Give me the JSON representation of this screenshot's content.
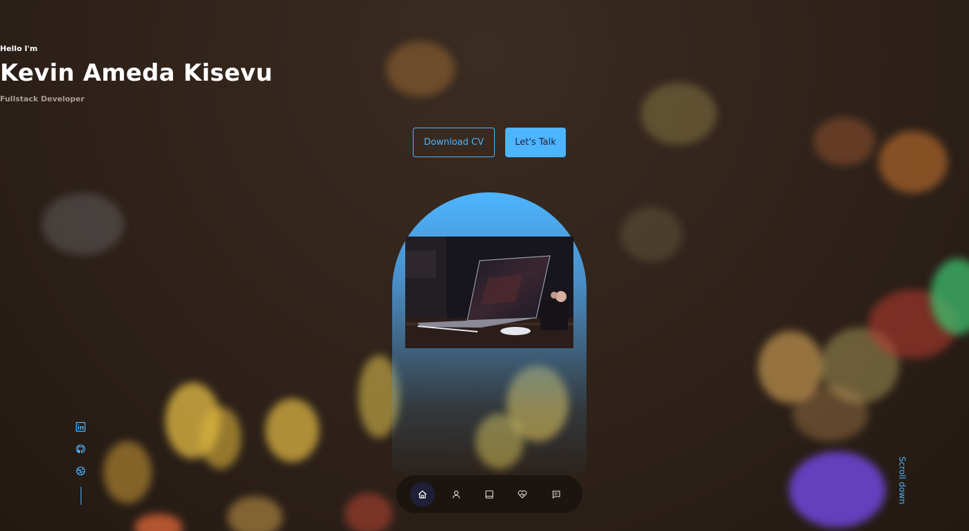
{
  "header": {
    "greeting": "Hello I'm",
    "name": "Kevin Ameda Kisevu",
    "role": "Fullstack Developer"
  },
  "cta": {
    "download_label": "Download CV",
    "talk_label": "Let's Talk"
  },
  "socials": [
    {
      "icon": "linkedin-icon"
    },
    {
      "icon": "github-icon"
    },
    {
      "icon": "dribbble-icon"
    }
  ],
  "scroll": {
    "label": "Scroll down"
  },
  "nav": {
    "items": [
      {
        "icon": "home-icon",
        "active": true
      },
      {
        "icon": "user-icon",
        "active": false
      },
      {
        "icon": "book-icon",
        "active": false
      },
      {
        "icon": "services-icon",
        "active": false
      },
      {
        "icon": "message-icon",
        "active": false
      }
    ]
  },
  "colors": {
    "accent": "#4db5ff",
    "nav_active": "#1f1f38",
    "background": "#2d2119"
  }
}
